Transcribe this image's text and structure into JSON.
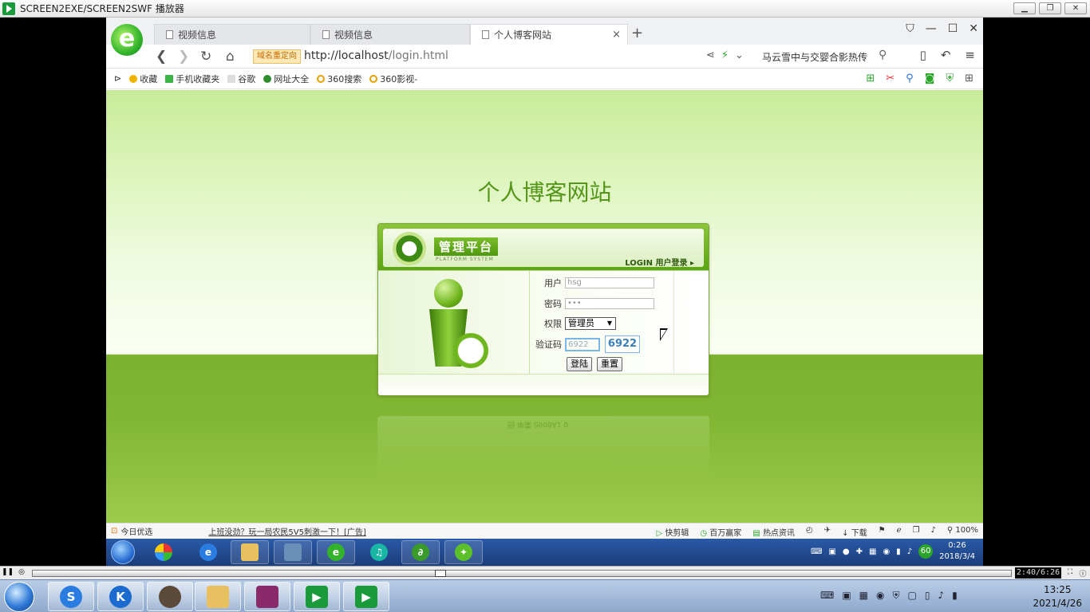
{
  "player": {
    "title": "SCREEN2EXE/SCREEN2SWF 播放器",
    "ctrl_min": "▁",
    "ctrl_restore": "❐",
    "ctrl_close": "✕",
    "time": "2:40/6:26"
  },
  "browser": {
    "logo_letter": "e",
    "tabs": [
      {
        "label": "视频信息",
        "active": false
      },
      {
        "label": "视频信息",
        "active": false
      },
      {
        "label": "个人博客网站",
        "active": true
      }
    ],
    "tab_close": "×",
    "tab_add": "+",
    "redirect_badge": "域名重定向",
    "url_host": "http://localhost",
    "url_path": "/login.html",
    "search_text": "马云雪中与交婴合影热传",
    "bookmarks": [
      {
        "label": "收藏",
        "icon": "star-icon",
        "color": "#f0b400"
      },
      {
        "label": "手机收藏夹",
        "icon": "phone-icon",
        "color": "#3ab54a"
      },
      {
        "label": "谷歌",
        "icon": "page-icon",
        "color": "#999999"
      },
      {
        "label": "网址大全",
        "icon": "globe-icon",
        "color": "#2e8b2e"
      },
      {
        "label": "360搜索",
        "icon": "search360-icon",
        "color": "#e6a000"
      },
      {
        "label": "360影视-",
        "icon": "video360-icon",
        "color": "#e6a000"
      }
    ]
  },
  "page": {
    "title": "个人博客网站",
    "login": {
      "platform_title": "管理平台",
      "platform_sub": "PLATFORM SYSTEM",
      "login_link": "LOGIN 用户登录 ▸",
      "user_label": "用户",
      "user_value": "hsg",
      "password_label": "密码",
      "password_value": "•••",
      "role_label": "权限",
      "role_value": "管理员",
      "captcha_label": "验证码",
      "captcha_input": "6922",
      "captcha_image": "6922",
      "login_button": "登陆",
      "reset_button": "重置"
    },
    "reflection_text": "0 1A800S 菜单 回"
  },
  "statusbar": {
    "left_label": "今日优选",
    "news": "上班没劲？玩一局农民5V5刺激一下！[广告]",
    "items": [
      "快剪辑",
      "百万赢家",
      "热点资讯",
      "下载",
      "100%"
    ]
  },
  "inner_taskbar": {
    "tray_badge": "60",
    "time": "0:26",
    "date": "2018/3/4"
  },
  "host_taskbar": {
    "time": "13:25",
    "date": "2021/4/26"
  },
  "colors": {
    "brand_green": "#55961a",
    "captcha_blue": "#3a7fb8"
  }
}
